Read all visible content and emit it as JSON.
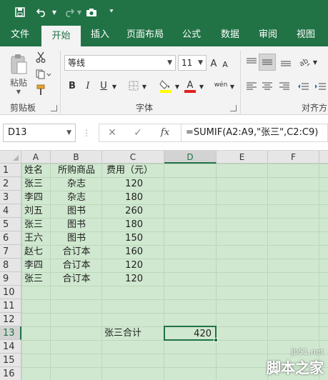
{
  "qat": {
    "save_icon": "save-icon",
    "undo_icon": "undo-icon",
    "redo_icon": "redo-icon",
    "camera_icon": "camera-icon",
    "customize_icon": "chevron-down-icon"
  },
  "tabs": [
    "文件",
    "开始",
    "插入",
    "页面布局",
    "公式",
    "数据",
    "审阅",
    "视图"
  ],
  "active_tab": "开始",
  "ribbon": {
    "clipboard": {
      "paste_label": "粘贴",
      "group_label": "剪贴板"
    },
    "font": {
      "font_name": "等线",
      "font_size": "11",
      "group_label": "字体",
      "bold": "B",
      "italic": "I",
      "underline": "U",
      "phonetic": "wén"
    },
    "alignment": {
      "group_label": "对齐方"
    }
  },
  "formula_bar": {
    "name_box": "D13",
    "formula": "=SUMIF(A2:A9,\"张三\",C2:C9)",
    "cancel_symbol": "✕",
    "enter_symbol": "✓",
    "fx_label": "fx"
  },
  "columns": [
    "A",
    "B",
    "C",
    "D",
    "E",
    "F"
  ],
  "selected_column": "D",
  "rows": [
    "1",
    "2",
    "3",
    "4",
    "5",
    "6",
    "7",
    "8",
    "9",
    "10",
    "11",
    "12",
    "13",
    "14",
    "15",
    "16"
  ],
  "selected_row": "13",
  "table": {
    "headers": [
      "姓名",
      "所购商品",
      "费用（元）"
    ],
    "records": [
      [
        "张三",
        "杂志",
        "120"
      ],
      [
        "李四",
        "杂志",
        "180"
      ],
      [
        "刘五",
        "图书",
        "260"
      ],
      [
        "张三",
        "图书",
        "180"
      ],
      [
        "王六",
        "图书",
        "150"
      ],
      [
        "赵七",
        "合订本",
        "160"
      ],
      [
        "李四",
        "合订本",
        "120"
      ],
      [
        "张三",
        "合订本",
        "120"
      ]
    ]
  },
  "summary": {
    "label": "张三合计",
    "value": "420"
  },
  "watermark": {
    "url": "jb51.net",
    "name": "脚本之家"
  },
  "colors": {
    "accent": "#217346",
    "sheet_bg": "#cfe8cf"
  }
}
